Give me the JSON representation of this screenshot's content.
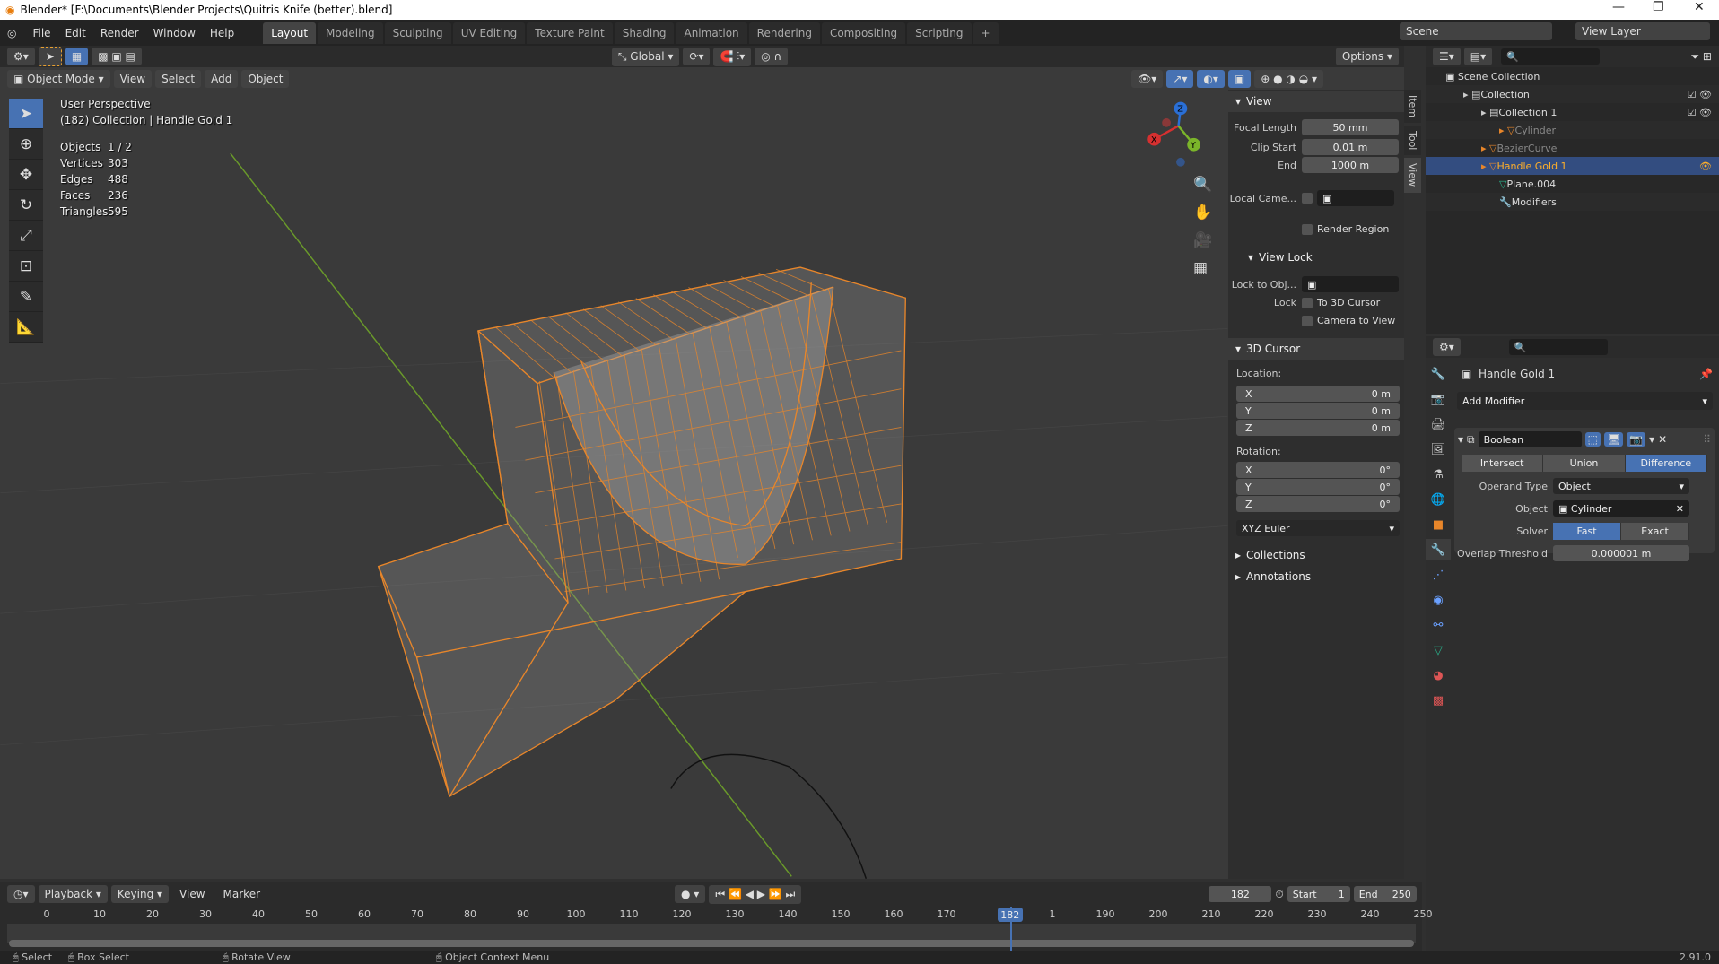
{
  "window": {
    "title": "Blender* [F:\\Documents\\Blender Projects\\Quitris Knife (better).blend]",
    "minimize": "—",
    "restore": "❐",
    "close": "✕"
  },
  "menu": [
    "File",
    "Edit",
    "Render",
    "Window",
    "Help"
  ],
  "workspaces": [
    "Layout",
    "Modeling",
    "Sculpting",
    "UV Editing",
    "Texture Paint",
    "Shading",
    "Animation",
    "Rendering",
    "Compositing",
    "Scripting",
    "+"
  ],
  "active_workspace": "Layout",
  "scene": {
    "scene_label": "Scene",
    "view_layer_label": "View Layer"
  },
  "viewport": {
    "transform_orientation": "Global",
    "options": "Options",
    "mode": "Object Mode",
    "menus": [
      "View",
      "Select",
      "Add",
      "Object"
    ],
    "overlay_title": "User Perspective",
    "overlay_subtitle": "(182) Collection | Handle Gold 1",
    "stats": [
      {
        "k": "Objects",
        "v": "1 / 2"
      },
      {
        "k": "Vertices",
        "v": "303"
      },
      {
        "k": "Edges",
        "v": "488"
      },
      {
        "k": "Faces",
        "v": "236"
      },
      {
        "k": "Triangles",
        "v": "595"
      }
    ],
    "gizmo": {
      "x": "X",
      "y": "Y",
      "z": "Z"
    },
    "colors": {
      "wire": "#e8862a",
      "axis_y": "#6a9a2a",
      "select": "#4772b3"
    }
  },
  "npanel": {
    "tabs": [
      "Item",
      "Tool",
      "View"
    ],
    "active_tab": "View",
    "view": {
      "title": "View",
      "focal_length_label": "Focal Length",
      "focal_length": "50 mm",
      "clip_start_label": "Clip Start",
      "clip_start": "0.01 m",
      "end_label": "End",
      "end": "1000 m",
      "local_camera_label": "Local Came...",
      "render_region": "Render Region"
    },
    "view_lock": {
      "title": "View Lock",
      "lock_to_obj_label": "Lock to Obj...",
      "lock_label": "Lock",
      "to_3d_cursor": "To 3D Cursor",
      "camera_to_view": "Camera to View"
    },
    "cursor": {
      "title": "3D Cursor",
      "location_label": "Location:",
      "location": [
        {
          "a": "X",
          "v": "0 m"
        },
        {
          "a": "Y",
          "v": "0 m"
        },
        {
          "a": "Z",
          "v": "0 m"
        }
      ],
      "rotation_label": "Rotation:",
      "rotation": [
        {
          "a": "X",
          "v": "0°"
        },
        {
          "a": "Y",
          "v": "0°"
        },
        {
          "a": "Z",
          "v": "0°"
        }
      ],
      "rotation_mode": "XYZ Euler"
    },
    "collections": "Collections",
    "annotations": "Annotations"
  },
  "outliner": {
    "root": "Scene Collection",
    "rows": [
      {
        "label": "Collection",
        "indent": 1,
        "icon": "collection-icon"
      },
      {
        "label": "Collection 1",
        "indent": 2,
        "icon": "collection-icon"
      },
      {
        "label": "Cylinder",
        "indent": 3,
        "icon": "mesh-object-icon"
      },
      {
        "label": "BezierCurve",
        "indent": 2,
        "icon": "mesh-object-icon"
      },
      {
        "label": "Handle Gold 1",
        "indent": 2,
        "icon": "mesh-object-icon",
        "selected": true
      },
      {
        "label": "Plane.004",
        "indent": 3,
        "icon": "mesh-data-icon"
      },
      {
        "label": "Modifiers",
        "indent": 3,
        "icon": "wrench-icon"
      }
    ]
  },
  "properties": {
    "object_name": "Handle Gold 1",
    "add_modifier": "Add Modifier",
    "modifier": {
      "name": "Boolean",
      "operations": [
        "Intersect",
        "Union",
        "Difference"
      ],
      "active_operation": "Difference",
      "operand_type_label": "Operand Type",
      "operand_type": "Object",
      "object_label": "Object",
      "object": "Cylinder",
      "solver_label": "Solver",
      "solvers": [
        "Fast",
        "Exact"
      ],
      "active_solver": "Fast",
      "overlap_label": "Overlap Threshold",
      "overlap": "0.000001 m"
    }
  },
  "timeline": {
    "menus": [
      "Playback",
      "Keying",
      "View",
      "Marker"
    ],
    "current_frame": "182",
    "start_label": "Start",
    "start": "1",
    "end_label": "End",
    "end": "250",
    "ticks": [
      "0",
      "10",
      "20",
      "30",
      "40",
      "50",
      "60",
      "70",
      "80",
      "90",
      "100",
      "110",
      "120",
      "130",
      "140",
      "150",
      "160",
      "170",
      "1",
      "190",
      "200",
      "210",
      "220",
      "230",
      "240",
      "250"
    ]
  },
  "statusbar": {
    "select": "Select",
    "box_select": "Box Select",
    "rotate_view": "Rotate View",
    "context_menu": "Object Context Menu",
    "version": "2.91.0"
  }
}
